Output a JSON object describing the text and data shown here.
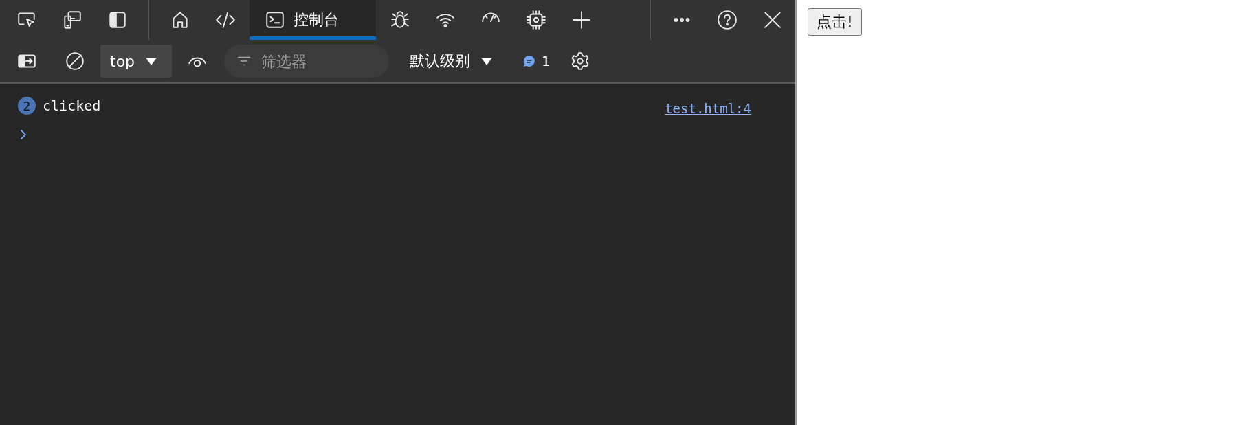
{
  "devtools": {
    "tabs": [
      {
        "kind": "welcome",
        "selected": false
      },
      {
        "kind": "elements",
        "selected": false
      },
      {
        "kind": "console",
        "label": "控制台",
        "selected": true
      },
      {
        "kind": "sources",
        "selected": false
      },
      {
        "kind": "network",
        "selected": false
      },
      {
        "kind": "performance",
        "selected": false
      },
      {
        "kind": "memory",
        "selected": false
      }
    ],
    "console_toolbar": {
      "context": "top",
      "filter_placeholder": "筛选器",
      "levels": "默认级别",
      "message_count": "1"
    },
    "messages": [
      {
        "repeat_count": "2",
        "text": "clicked",
        "source": "test.html:4"
      }
    ]
  },
  "page": {
    "button": "点击!"
  }
}
